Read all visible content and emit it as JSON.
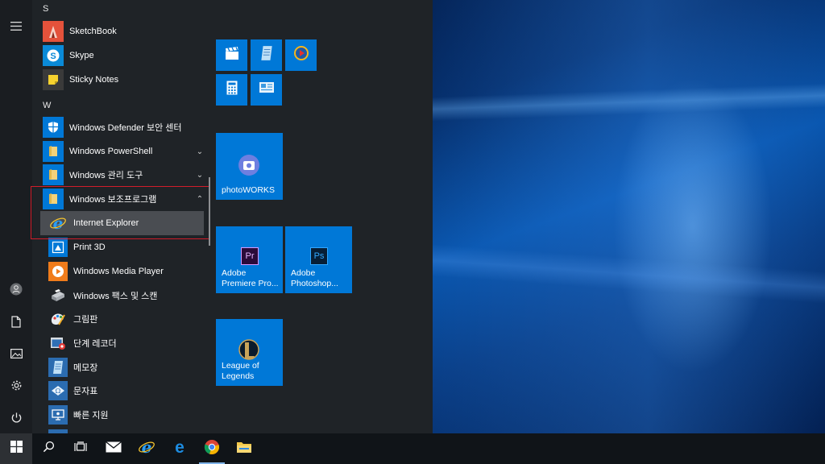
{
  "start_menu": {
    "letters": [
      "S",
      "W"
    ],
    "apps_s": [
      {
        "label": "SketchBook",
        "icon": "sketchbook-icon"
      },
      {
        "label": "Skype",
        "icon": "skype-icon"
      },
      {
        "label": "Sticky Notes",
        "icon": "sticky-notes-icon"
      }
    ],
    "apps_w": [
      {
        "label": "Windows Defender 보안 센터",
        "icon": "shield-icon"
      },
      {
        "label": "Windows PowerShell",
        "icon": "folder-icon",
        "chevron": "⌄"
      },
      {
        "label": "Windows 관리 도구",
        "icon": "folder-icon",
        "chevron": "⌄"
      },
      {
        "label": "Windows 보조프로그램",
        "icon": "folder-icon",
        "chevron": "⌃"
      }
    ],
    "accessories": [
      {
        "label": "Internet Explorer",
        "icon": "internet-explorer-icon"
      },
      {
        "label": "Print 3D",
        "icon": "print-3d-icon"
      },
      {
        "label": "Windows Media Player",
        "icon": "media-player-icon"
      },
      {
        "label": "Windows 팩스 및 스캔",
        "icon": "fax-scan-icon"
      },
      {
        "label": "그림판",
        "icon": "paint-icon"
      },
      {
        "label": "단계 레코더",
        "icon": "steps-recorder-icon"
      },
      {
        "label": "메모장",
        "icon": "notepad-icon"
      },
      {
        "label": "문자표",
        "icon": "character-map-icon"
      },
      {
        "label": "빠른 지원",
        "icon": "quick-assist-icon"
      }
    ]
  },
  "tiles": {
    "photoworks": "photoWORKS",
    "premiere": "Adobe Premiere Pro...",
    "photoshop": "Adobe Photoshop...",
    "lol": "League of Legends",
    "premiere_badge": "Pr",
    "photoshop_badge": "Ps"
  },
  "colors": {
    "tile_blue": "#0078d7",
    "menu_bg": "#1f2327",
    "highlight_red": "#d11d2b"
  }
}
